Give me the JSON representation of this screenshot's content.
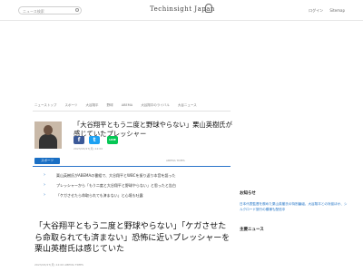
{
  "header": {
    "search_placeholder": "ニュース検索",
    "logo": "Techinsight Japan",
    "links": [
      "ログイン",
      "Sitemap"
    ]
  },
  "breadcrumb": [
    "ニューストップ",
    "スポーツ",
    "大谷翔平",
    "野球",
    "ABEMA",
    "大谷翔平のライバル",
    "大谷ニュース"
  ],
  "article": {
    "title": "「大谷翔平ともう二度と野球やらない」栗山英樹氏が感じていたプレッシャー",
    "meta": "2023/03/27(月) 12:00",
    "share": {
      "facebook": "f",
      "twitter": "t",
      "line": "LINE"
    },
    "category": "スポーツ",
    "credit": "ABEMA TIMES",
    "points": [
      "栗山英樹氏がABEMAの番組で、大谷翔平とWBCを振り返り本音を語った",
      "プレッシャーから「もう二度と大谷翔平と野球やらない」と思ったと告白",
      "「ケガさせたら命取られても済まない」と心境も吐露"
    ],
    "headline": "「大谷翔平ともう二度と野球やらない」「ケガさせたら命取られても済まない」恐怖に近いプレッシャーを栗山英樹氏は感じていた",
    "foot_meta": "2023/03/27(月) 12:00  ABEMA TIMES"
  },
  "sidebar": {
    "section1_title": "お知らせ",
    "section1_text": "日本代表監督を務めた栗山英樹氏の特別番組、大谷翔平との対談ほか、シルクロード旅行の模様も配信中",
    "section2_title": "主要ニュース"
  }
}
